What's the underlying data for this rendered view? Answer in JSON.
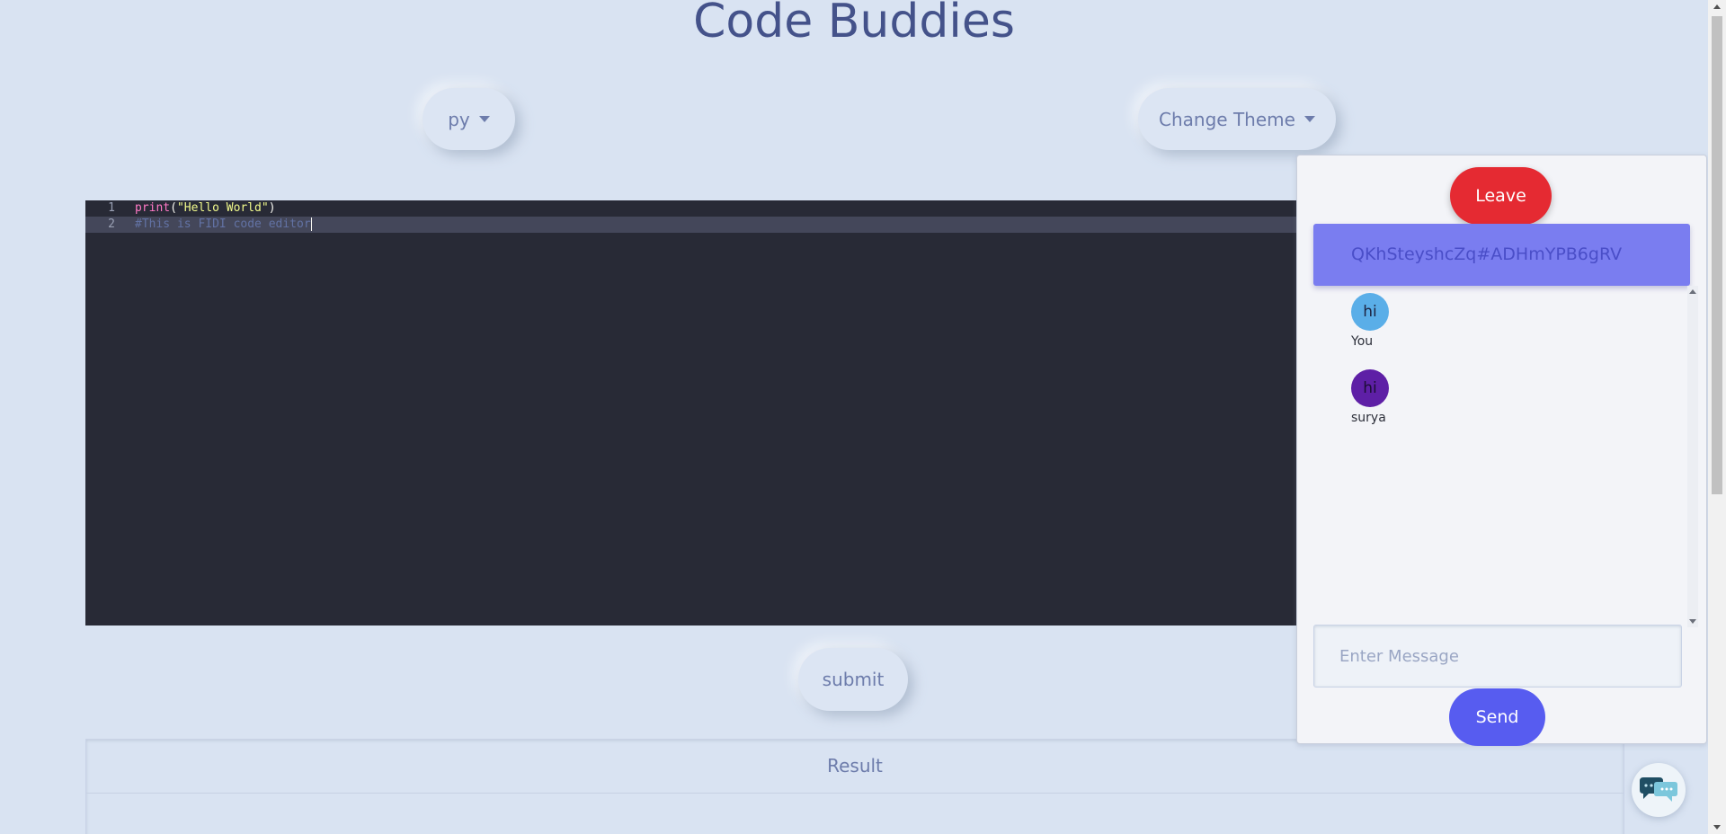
{
  "header": {
    "title": "Code Buddies"
  },
  "toolbar": {
    "language_label": "py",
    "theme_label": "Change Theme"
  },
  "editor": {
    "lines": [
      {
        "number": "1",
        "fn": "print",
        "open": "(",
        "str": "\"Hello World\"",
        "close": ")"
      },
      {
        "number": "2",
        "comment": "#This is FIDI code editor"
      }
    ]
  },
  "actions": {
    "submit_label": "submit"
  },
  "result": {
    "header": "Result"
  },
  "chat": {
    "leave_label": "Leave",
    "room_id": "QKhSteyshcZq#ADHmYPB6gRV",
    "messages": [
      {
        "text": "hi",
        "sender": "You"
      },
      {
        "text": "hi",
        "sender": "surya"
      }
    ],
    "input_placeholder": "Enter Message",
    "send_label": "Send"
  },
  "colors": {
    "background": "#d9e3f2",
    "editor_bg": "#282a36",
    "leave": "#e52a32",
    "send": "#575cf0",
    "room_id_bg": "#7a7df0"
  },
  "icons": {
    "language_caret": "chevron-down-icon",
    "theme_caret": "chevron-down-icon",
    "chat_fab": "chat-bubbles-icon"
  }
}
